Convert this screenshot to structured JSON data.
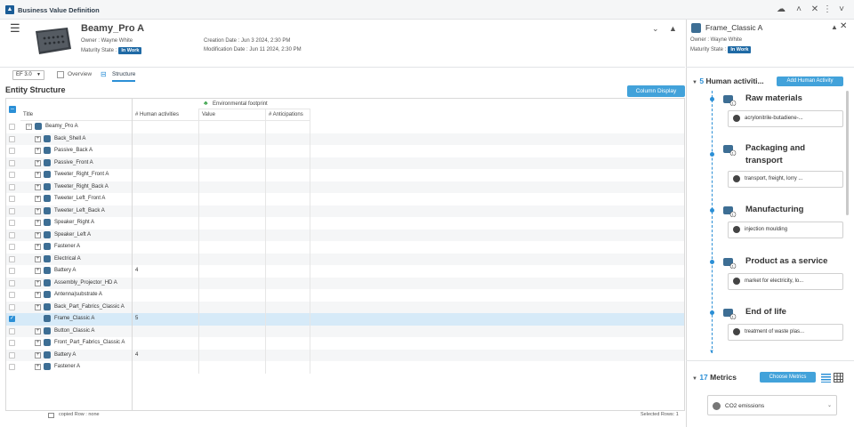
{
  "app": {
    "title": "Business Value Definition"
  },
  "object": {
    "title": "Beamy_Pro A",
    "owner": "Owner : Wayne White",
    "maturity_label": "Maturity State :",
    "maturity_value": "In Work",
    "creation": "Creation Date : Jun 3 2024, 2:30 PM",
    "modification": "Modification Date : Jun 11 2024, 2:30 PM"
  },
  "toolbar": {
    "version": "EF 3.0",
    "tab_overview": "Overview",
    "tab_structure": "Structure"
  },
  "section": {
    "title": "Entity Structure",
    "column_display": "Column Display"
  },
  "table": {
    "group_header": "Environmental footprint",
    "col_title": "Title",
    "col_human": "# Human activities",
    "col_value": "Value",
    "col_anticip": "# Anticipations",
    "rows": [
      {
        "label": "Beamy_Pro  A",
        "level": 0,
        "value": "",
        "selected": false
      },
      {
        "label": "Back_Shell  A",
        "level": 1,
        "value": "",
        "selected": false
      },
      {
        "label": "Passive_Back  A",
        "level": 1,
        "value": "",
        "selected": false
      },
      {
        "label": "Passive_Front  A",
        "level": 1,
        "value": "",
        "selected": false
      },
      {
        "label": "Tweeter_Right_Front  A",
        "level": 1,
        "value": "",
        "selected": false
      },
      {
        "label": "Tweeter_Right_Back  A",
        "level": 1,
        "value": "",
        "selected": false
      },
      {
        "label": "Tweeter_Left_Front  A",
        "level": 1,
        "value": "",
        "selected": false
      },
      {
        "label": "Tweeter_Left_Back  A",
        "level": 1,
        "value": "",
        "selected": false
      },
      {
        "label": "Speaker_Right  A",
        "level": 1,
        "value": "",
        "selected": false
      },
      {
        "label": "Speaker_Left  A",
        "level": 1,
        "value": "",
        "selected": false
      },
      {
        "label": "Fastener  A",
        "level": 1,
        "value": "",
        "selected": false
      },
      {
        "label": "Electrical  A",
        "level": 1,
        "value": "",
        "selected": false
      },
      {
        "label": "Battery  A",
        "level": 1,
        "value": "4",
        "selected": false
      },
      {
        "label": "Assembly_Projector_HD  A",
        "level": 1,
        "value": "",
        "selected": false
      },
      {
        "label": "Antenna|substrate  A",
        "level": 1,
        "value": "",
        "selected": false
      },
      {
        "label": "Back_Part_Fabrics_Classic  A",
        "level": 1,
        "value": "",
        "selected": false
      },
      {
        "label": "Frame_Classic  A",
        "level": 1,
        "value": "5",
        "selected": true
      },
      {
        "label": "Button_Classic  A",
        "level": 1,
        "value": "",
        "selected": false
      },
      {
        "label": "Front_Part_Fabrics_Classic  A",
        "level": 1,
        "value": "",
        "selected": false
      },
      {
        "label": "Battery  A",
        "level": 1,
        "value": "4",
        "selected": false
      },
      {
        "label": "Fastener  A",
        "level": 1,
        "value": "",
        "selected": false
      }
    ]
  },
  "status": {
    "copied": "copied Row : none",
    "selected": "Selected Rows: 1"
  },
  "panel": {
    "title": "Frame_Classic A",
    "owner": "Owner : Wayne White",
    "maturity_label": "Maturity State :",
    "maturity_value": "In Work",
    "human_count": "5",
    "human_label": "Human activiti...",
    "add_human": "Add Human Activity",
    "stages": [
      {
        "title": "Raw materials",
        "title2": "",
        "item": "acrylonitrile-butadiene-..."
      },
      {
        "title": "Packaging and",
        "title2": "transport",
        "item": "transport, freight, lorry ..."
      },
      {
        "title": "Manufacturing",
        "title2": "",
        "item": "injection moulding"
      },
      {
        "title": "Product as a service",
        "title2": "",
        "item": "market for electricity, lo..."
      },
      {
        "title": "End of life",
        "title2": "",
        "item": "treatment of waste plas..."
      }
    ],
    "metrics_count": "17",
    "metrics_label": "Metrics",
    "choose_metrics": "Choose Metrics",
    "metric_item": "CO2 emissions"
  },
  "colors": {
    "accent": "#42a2da",
    "badge": "#1f6aa5",
    "selected_row": "#d6eaf8"
  }
}
